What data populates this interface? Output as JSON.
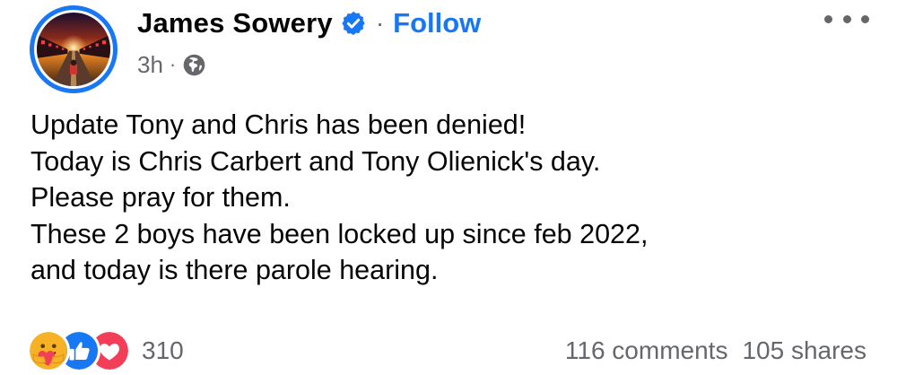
{
  "author": {
    "name": "James Sowery",
    "verified": true,
    "separator": "·",
    "follow_label": "Follow"
  },
  "meta": {
    "time": "3h",
    "separator": "·",
    "audience_icon": "globe-icon"
  },
  "menu_icon": "more-options-icon",
  "post": {
    "lines": [
      "Update Tony and Chris has been denied!",
      "Today is Chris Carbert and Tony Olienick's day.",
      "Please pray for them.",
      "These 2 boys have been locked up since feb 2022,",
      "and today is there parole hearing."
    ]
  },
  "reactions": {
    "icons": [
      "care-icon",
      "like-icon",
      "love-icon"
    ],
    "count": "310"
  },
  "stats": {
    "comments": "116 comments",
    "shares": "105 shares"
  },
  "colors": {
    "accent": "#1877f2",
    "text": "#050505",
    "secondary_text": "#65676b",
    "love": "#f33e58",
    "care": "#f7b125"
  }
}
